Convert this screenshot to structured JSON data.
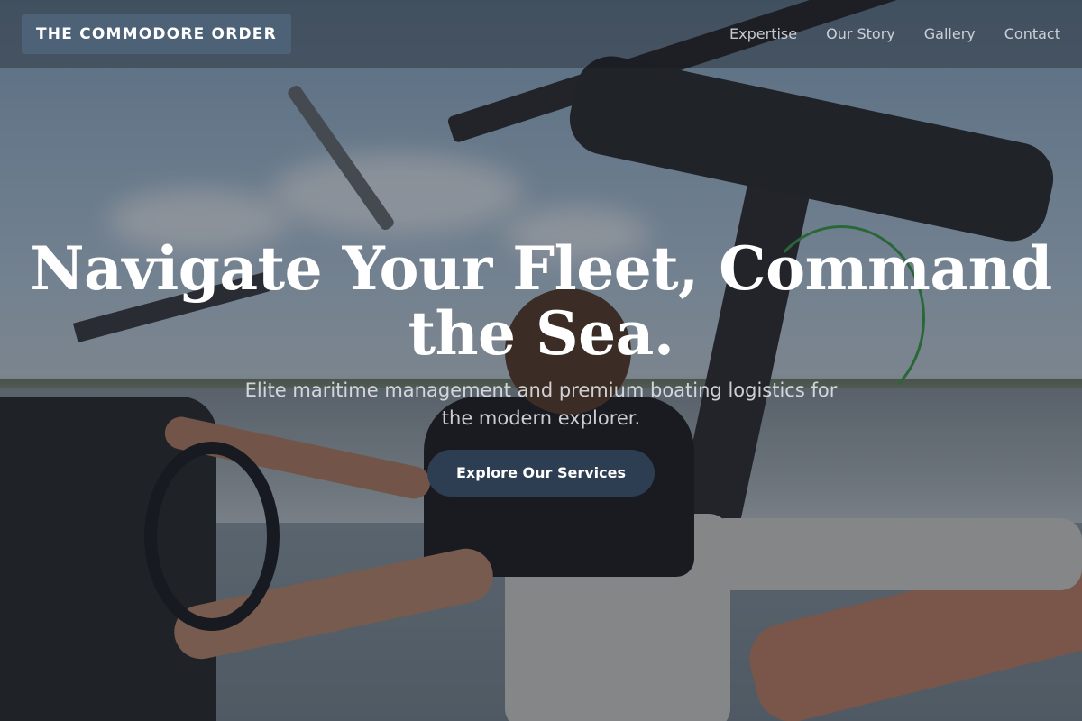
{
  "header": {
    "brand": "THE COMMODORE ORDER",
    "nav": [
      {
        "label": "Expertise"
      },
      {
        "label": "Our Story"
      },
      {
        "label": "Gallery"
      },
      {
        "label": "Contact"
      }
    ]
  },
  "hero": {
    "headline": "Navigate Your Fleet, Command the Sea.",
    "subheadline": "Elite maritime management and premium boating logistics for the modern explorer.",
    "cta_label": "Explore Our Services",
    "background_image": "person-driving-speedboat-with-wakeboards-photo"
  },
  "colors": {
    "brand_bg": "#4d6277",
    "cta_bg": "#2e3e52",
    "overlay": "#10161e"
  }
}
